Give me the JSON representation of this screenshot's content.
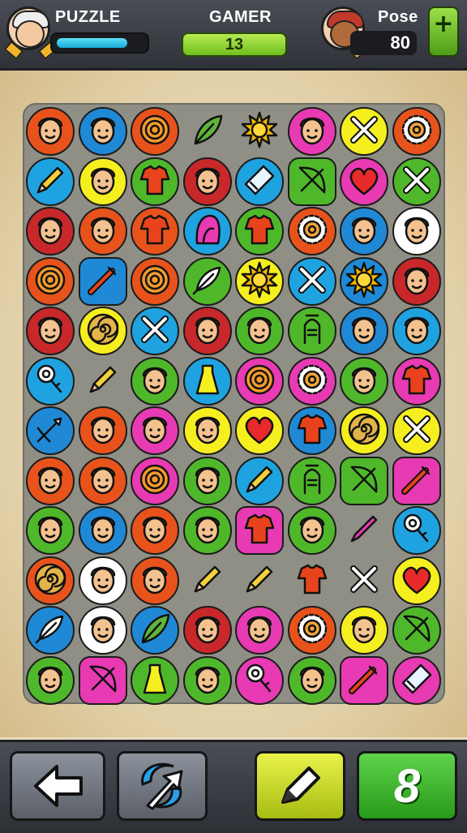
{
  "header": {
    "player1_label": "PUZZLE",
    "center_label": "GAMER",
    "level_value": "13",
    "player2_label": "Pose",
    "score_value": "80",
    "plus_label": "+",
    "progress_fraction": 0.82
  },
  "footer": {
    "counter_value": "8"
  },
  "board": {
    "rows": [
      [
        [
          "face",
          "#e8531c"
        ],
        [
          "face",
          "#1f89d6"
        ],
        [
          "target",
          "#e8531c"
        ],
        [
          "leaf",
          "none"
        ],
        [
          "sun",
          "none"
        ],
        [
          "face",
          "#e83ab3"
        ],
        [
          "crossed",
          "#f6ef1f"
        ],
        [
          "gear",
          "#e8531c"
        ]
      ],
      [
        [
          "pencil",
          "#1fa3e0"
        ],
        [
          "face",
          "#f6ef1f"
        ],
        [
          "shirt",
          "#4fb82a"
        ],
        [
          "face",
          "#c8282a"
        ],
        [
          "bottle",
          "#1fa3e0"
        ],
        [
          "bow",
          "#4fb82a",
          "sq"
        ],
        [
          "heart",
          "#e83ab3"
        ],
        [
          "crossed",
          "#4fb82a"
        ]
      ],
      [
        [
          "face",
          "#c8282a"
        ],
        [
          "face",
          "#e8531c"
        ],
        [
          "shirt",
          "#e8531c"
        ],
        [
          "hood",
          "#1fa3e0"
        ],
        [
          "shirt",
          "#4fb82a"
        ],
        [
          "gear",
          "#e8531c"
        ],
        [
          "face",
          "#1f89d6"
        ],
        [
          "face",
          "#ffffff"
        ]
      ],
      [
        [
          "target",
          "#e8531c"
        ],
        [
          "sword",
          "#1f89d6",
          "sq"
        ],
        [
          "target",
          "#e8531c"
        ],
        [
          "feather",
          "#4fb82a"
        ],
        [
          "sun",
          "#f6ef1f"
        ],
        [
          "crossed",
          "#1fa3e0"
        ],
        [
          "sun",
          "#1f89d6"
        ],
        [
          "face",
          "#c8282a"
        ]
      ],
      [
        [
          "face",
          "#c8282a"
        ],
        [
          "spiral",
          "#f6ef1f"
        ],
        [
          "crossed",
          "#1fa3e0"
        ],
        [
          "face",
          "#c8282a"
        ],
        [
          "face",
          "#4fb82a"
        ],
        [
          "tool",
          "#4fb82a"
        ],
        [
          "face",
          "#1f89d6"
        ],
        [
          "face",
          "#1fa3e0"
        ]
      ],
      [
        [
          "key",
          "#1fa3e0"
        ],
        [
          "pencil",
          "none"
        ],
        [
          "face",
          "#4fb82a"
        ],
        [
          "dress",
          "#1fa3e0"
        ],
        [
          "target",
          "#e83ab3"
        ],
        [
          "gear",
          "#e83ab3"
        ],
        [
          "face",
          "#4fb82a"
        ],
        [
          "shirt",
          "#e83ab3"
        ]
      ],
      [
        [
          "spear",
          "#1f89d6"
        ],
        [
          "face",
          "#e8531c"
        ],
        [
          "face",
          "#e83ab3"
        ],
        [
          "face",
          "#f6ef1f"
        ],
        [
          "heart",
          "#f6ef1f"
        ],
        [
          "shirt",
          "#1f89d6"
        ],
        [
          "spiral",
          "#f6ef1f"
        ],
        [
          "crossed",
          "#f6ef1f"
        ]
      ],
      [
        [
          "face",
          "#e8531c"
        ],
        [
          "face",
          "#e8531c"
        ],
        [
          "target",
          "#e83ab3"
        ],
        [
          "face",
          "#4fb82a"
        ],
        [
          "pencil",
          "#1fa3e0"
        ],
        [
          "tool",
          "#4fb82a"
        ],
        [
          "bow",
          "#4fb82a",
          "sq"
        ],
        [
          "sword",
          "#e83ab3",
          "sq"
        ]
      ],
      [
        [
          "face",
          "#4fb82a"
        ],
        [
          "face",
          "#1f89d6"
        ],
        [
          "face",
          "#e8531c"
        ],
        [
          "face",
          "#4fb82a"
        ],
        [
          "shirt",
          "#e83ab3",
          "sq"
        ],
        [
          "face",
          "#4fb82a"
        ],
        [
          "pen",
          "none"
        ],
        [
          "key",
          "#1fa3e0"
        ]
      ],
      [
        [
          "spiral",
          "#e8531c"
        ],
        [
          "face",
          "#ffffff"
        ],
        [
          "face",
          "#e8531c"
        ],
        [
          "pencil",
          "none"
        ],
        [
          "pencil",
          "none"
        ],
        [
          "shirt",
          "none"
        ],
        [
          "crossed",
          "none"
        ],
        [
          "heart",
          "#f6ef1f"
        ]
      ],
      [
        [
          "feather",
          "#1f89d6"
        ],
        [
          "face",
          "#ffffff"
        ],
        [
          "leaf",
          "#1f89d6"
        ],
        [
          "face",
          "#c8282a"
        ],
        [
          "face",
          "#e83ab3"
        ],
        [
          "gear",
          "#e8531c"
        ],
        [
          "face",
          "#f6ef1f"
        ],
        [
          "bow",
          "#4fb82a"
        ]
      ],
      [
        [
          "face",
          "#4fb82a"
        ],
        [
          "bow",
          "#e83ab3",
          "sq"
        ],
        [
          "dress",
          "#4fb82a"
        ],
        [
          "face",
          "#4fb82a"
        ],
        [
          "key",
          "#e83ab3"
        ],
        [
          "face",
          "#4fb82a"
        ],
        [
          "sword",
          "#e83ab3",
          "sq"
        ],
        [
          "bottle",
          "#e83ab3"
        ]
      ]
    ]
  },
  "colors": {
    "board_bg": "#8f8f86",
    "accent_green": "#6fbf1e",
    "accent_blue": "#18a9d6"
  },
  "icons": {
    "back_button": "back-arrow-icon",
    "shuffle_button": "swirl-arrow-icon",
    "hint_button": "pencil-icon",
    "plus_button": "plus-icon"
  }
}
